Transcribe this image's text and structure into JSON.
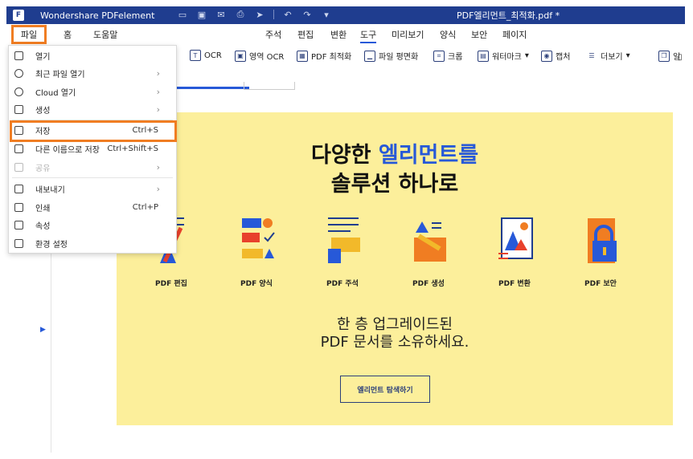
{
  "titlebar": {
    "app_name": "Wondershare PDFelement",
    "document": "PDF엘리먼트_최적화.pdf *"
  },
  "menubar": {
    "file": "파일",
    "home": "홈",
    "help": "도움말"
  },
  "ribbon_tabs": [
    "주석",
    "편집",
    "변환",
    "도구",
    "미리보기",
    "양식",
    "보안",
    "페이지"
  ],
  "active_ribbon_tab": "도구",
  "toolbar": {
    "ocr": "OCR",
    "area_ocr": "영역 OCR",
    "optimize": "PDF 최적화",
    "flatten": "파일 평면화",
    "crop": "크롭",
    "watermark": "워터마크",
    "capture": "캡처",
    "more": "더보기",
    "extra": "일"
  },
  "file_menu": {
    "open": "열기",
    "recent": "최근 파일 열기",
    "cloud": "Cloud 열기",
    "create": "생성",
    "save": "저장",
    "save_shortcut": "Ctrl+S",
    "save_as": "다른 이름으로 저장",
    "save_as_shortcut": "Ctrl+Shift+S",
    "share": "공유",
    "export": "내보내기",
    "print": "인쇄",
    "print_shortcut": "Ctrl+P",
    "properties": "속성",
    "preferences": "환경 설정"
  },
  "banner": {
    "headline_part1": "다양한 ",
    "headline_highlight": "엘리먼트를",
    "headline_line2": "솔루션 하나로",
    "features": [
      "PDF 편집",
      "PDF 양식",
      "PDF 주석",
      "PDF 생성",
      "PDF 변환",
      "PDF 보안"
    ],
    "subline1": "한 층 업그레이드된",
    "subline2": "PDF 문서를 소유하세요.",
    "cta": "엘리먼트 탐색하기"
  },
  "colors": {
    "title_bar": "#1f3d8f",
    "highlight_orange": "#f07d22",
    "banner_bg": "#fcef9b",
    "accent_blue": "#2759d8"
  }
}
